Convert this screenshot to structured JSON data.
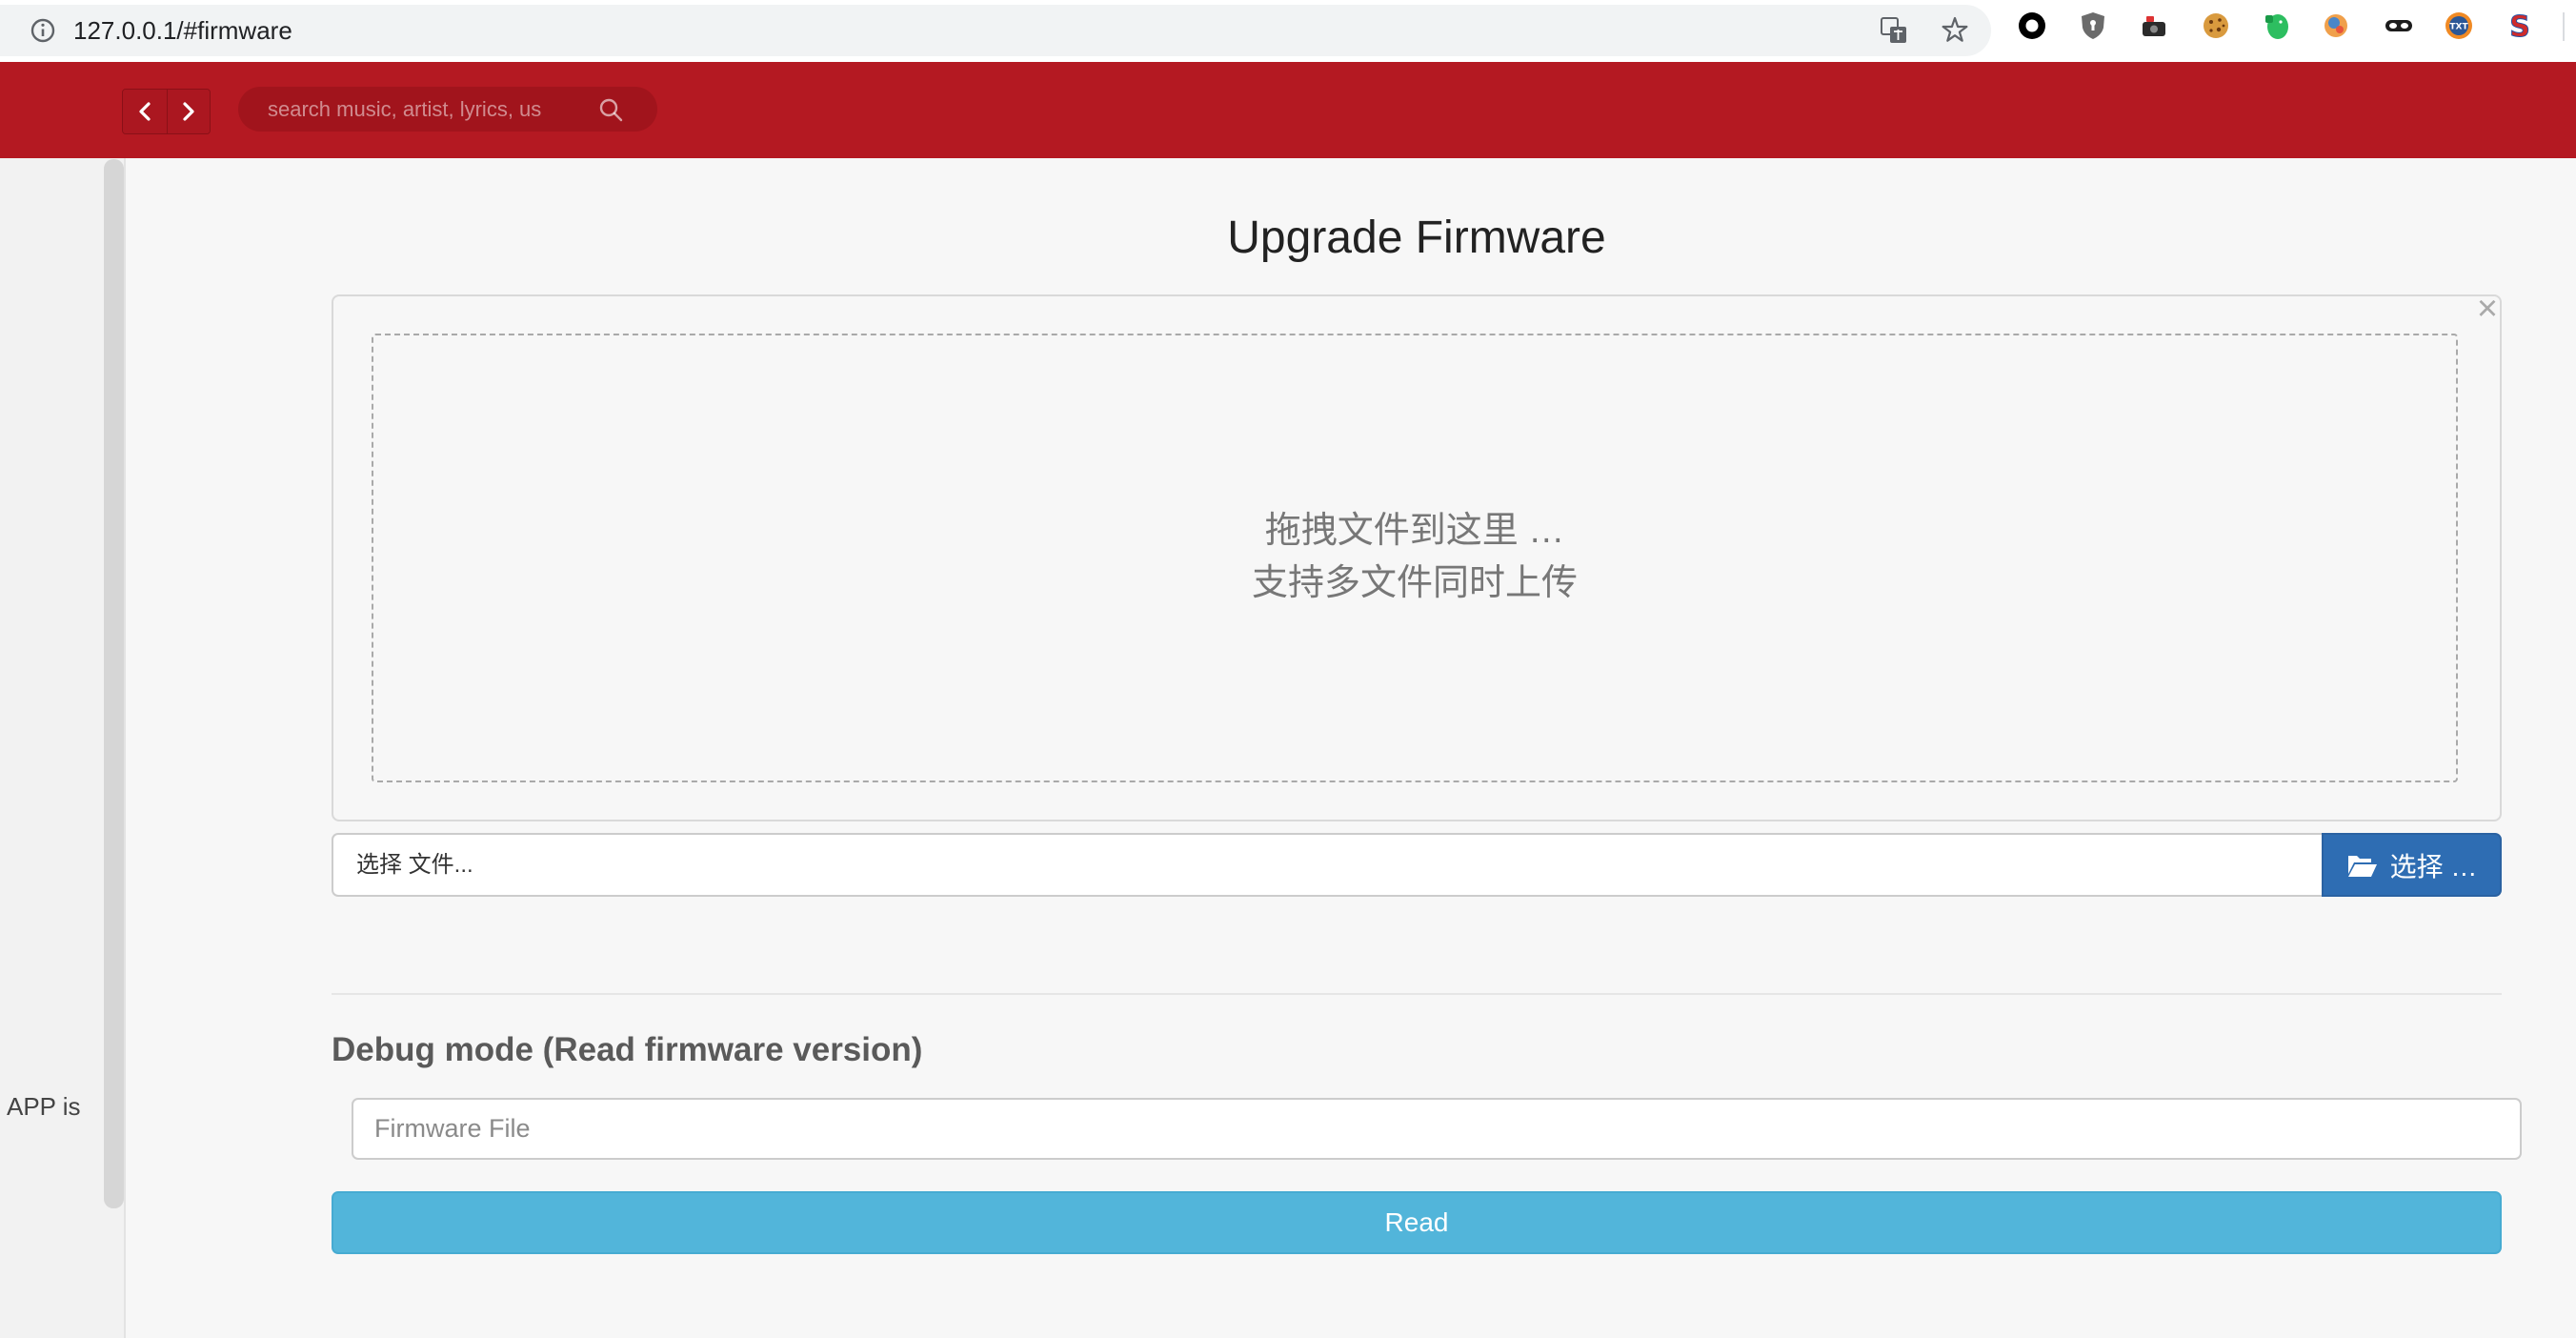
{
  "browser": {
    "url": "127.0.0.1/#firmware",
    "extensions": [
      {
        "icon": "ring-extension-icon"
      },
      {
        "icon": "shield-extension-icon"
      },
      {
        "icon": "camera-extension-icon"
      },
      {
        "icon": "cookie-extension-icon"
      },
      {
        "icon": "evernote-extension-icon"
      },
      {
        "icon": "head-extension-icon"
      },
      {
        "icon": "mask-extension-icon"
      },
      {
        "icon": "txt-extension-icon",
        "logo_text": "TXT"
      },
      {
        "icon": "s-extension-icon",
        "logo_text": "S"
      }
    ]
  },
  "header": {
    "search_placeholder": "search music, artist, lyrics, us"
  },
  "sidebar": {
    "status_text": "APP is"
  },
  "firmware": {
    "title": "Upgrade Firmware",
    "close_label": "×",
    "drop_line_1": "拖拽文件到这里 …",
    "drop_line_2": "支持多文件同时上传",
    "file_caption": "选择 文件...",
    "browse_label": "选择 …"
  },
  "debug": {
    "heading": "Debug mode (Read firmware version)",
    "file_placeholder": "Firmware File",
    "read_label": "Read"
  },
  "colors": {
    "header": "#b41922",
    "primary_button": "#2e6db3",
    "info_button": "#52b5da"
  }
}
